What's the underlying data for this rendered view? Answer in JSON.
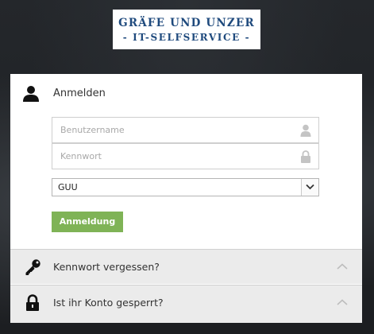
{
  "logo": {
    "line1": "GRÄFE UND UNZER",
    "line2": "- IT-SELFSERVICE -"
  },
  "login": {
    "title": "Anmelden",
    "username_placeholder": "Benutzername",
    "password_placeholder": "Kennwort",
    "domain_value": "GUU",
    "submit_label": "Anmeldung"
  },
  "accordion": {
    "forgot_password": "Kennwort vergessen?",
    "account_locked": "Ist ihr Konto gesperrt?"
  },
  "colors": {
    "brand_blue": "#1f4a7d",
    "button_green": "#7fb356",
    "accordion_bg": "#ebebeb"
  },
  "icons": {
    "user": "user-icon",
    "username_field": "person-icon",
    "password_field": "lock-icon",
    "dropdown": "chevron-down-icon",
    "forgot": "key-icon",
    "locked": "padlock-icon",
    "collapse": "chevron-up-icon"
  }
}
